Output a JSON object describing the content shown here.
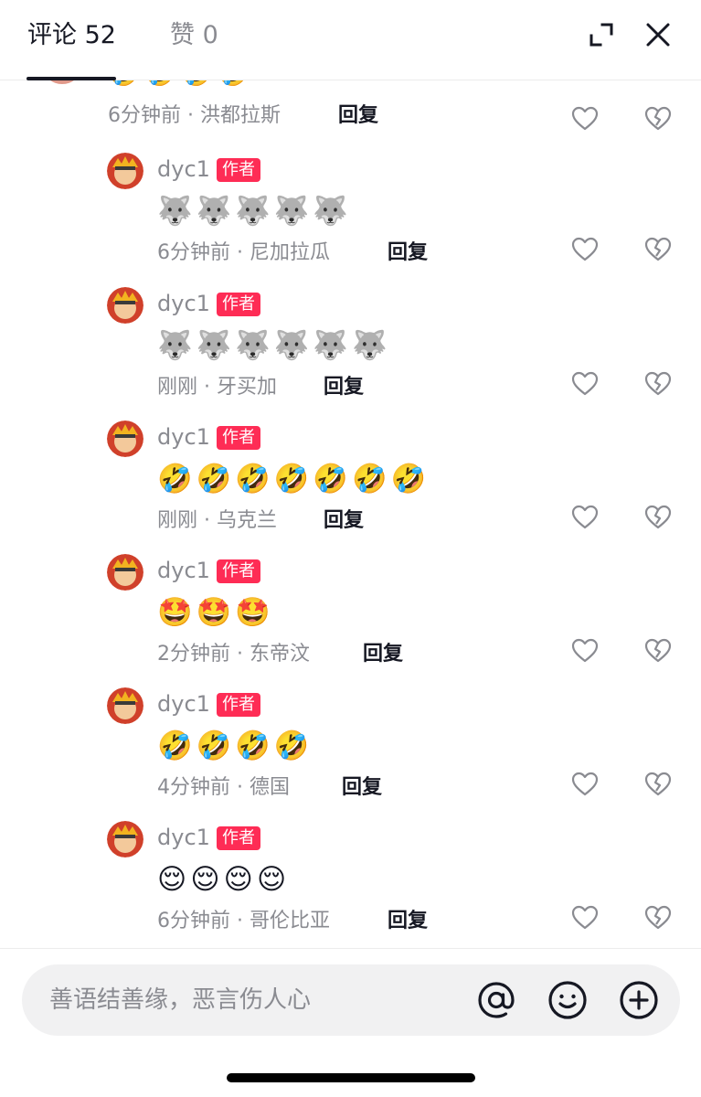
{
  "header": {
    "tab_comments": "评论 52",
    "tab_likes": "赞 0",
    "expand_icon": "expand-icon",
    "close_icon": "close-icon"
  },
  "top_partial": {
    "emojis": "🤣🤣🤣🤣",
    "time": "6分钟前",
    "location": "洪都拉斯",
    "reply_label": "回复"
  },
  "replies": [
    {
      "author": "dyc1",
      "badge": "作者",
      "emojis": "🐺🐺🐺🐺🐺",
      "time": "6分钟前",
      "location": "尼加拉瓜",
      "reply_label": "回复"
    },
    {
      "author": "dyc1",
      "badge": "作者",
      "emojis": "🐺🐺🐺🐺🐺🐺",
      "time": "刚刚",
      "location": "牙买加",
      "reply_label": "回复"
    },
    {
      "author": "dyc1",
      "badge": "作者",
      "emojis": "🤣🤣🤣🤣🤣🤣🤣",
      "time": "刚刚",
      "location": "乌克兰",
      "reply_label": "回复"
    },
    {
      "author": "dyc1",
      "badge": "作者",
      "emojis": "🤩🤩🤩",
      "time": "2分钟前",
      "location": "东帝汶",
      "reply_label": "回复"
    },
    {
      "author": "dyc1",
      "badge": "作者",
      "emojis": "🤣🤣🤣🤣",
      "time": "4分钟前",
      "location": "德国",
      "reply_label": "回复"
    },
    {
      "author": "dyc1",
      "badge": "作者",
      "emojis": "😌😌😌😌",
      "time": "6分钟前",
      "location": "哥伦比亚",
      "reply_label": "回复"
    }
  ],
  "composer": {
    "placeholder": "善语结善缘，恶言伤人心",
    "icons": [
      "at-icon",
      "emoji-icon",
      "plus-icon"
    ]
  },
  "colors": {
    "badge": "#fe2c55",
    "text_primary": "#161823",
    "text_secondary": "#8a8b91",
    "input_bg": "#f1f1f2"
  }
}
